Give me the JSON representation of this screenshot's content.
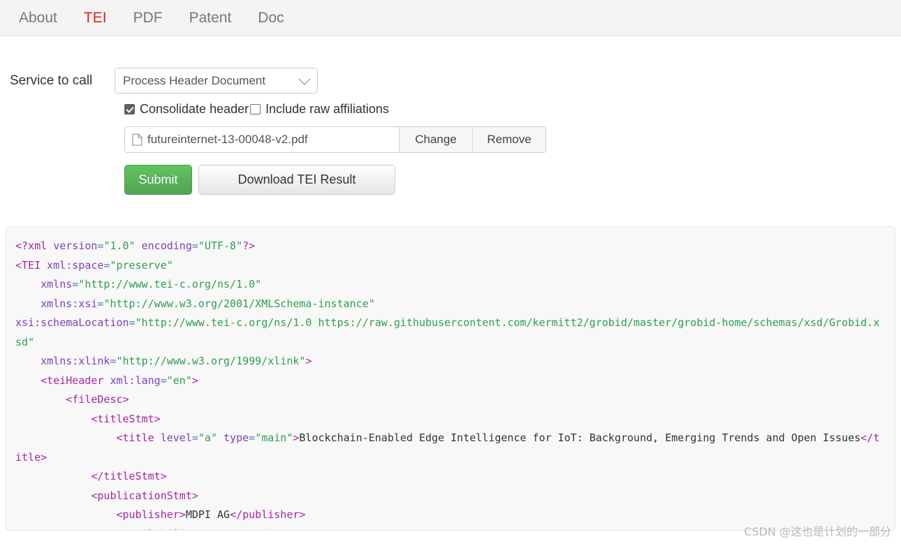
{
  "nav": {
    "items": [
      {
        "label": "About",
        "active": false
      },
      {
        "label": "TEI",
        "active": true
      },
      {
        "label": "PDF",
        "active": false
      },
      {
        "label": "Patent",
        "active": false
      },
      {
        "label": "Doc",
        "active": false
      }
    ],
    "active_color": "#d9241f",
    "inactive_color": "#777777",
    "background": "#f4f4f4"
  },
  "form": {
    "service_label": "Service to call",
    "service_selected": "Process Header Document",
    "dropdown_icon": "chevron-down-icon",
    "checkboxes": [
      {
        "label": "Consolidate header",
        "checked": true
      },
      {
        "label": "Include raw affiliations",
        "checked": false
      }
    ],
    "file": {
      "icon": "document-icon",
      "name": "futureinternet-13-00048-v2.pdf",
      "change_label": "Change",
      "remove_label": "Remove"
    },
    "submit_label": "Submit",
    "submit_color": "#5cb85c",
    "download_label": "Download TEI Result"
  },
  "code": {
    "language": "xml",
    "lines": [
      [
        {
          "t": "<?xml ",
          "c": "t-tag"
        },
        {
          "t": "version",
          "c": "t-attr"
        },
        {
          "t": "=",
          "c": "t-punc"
        },
        {
          "t": "\"1.0\"",
          "c": "t-val"
        },
        {
          "t": " ",
          "c": "t-txt"
        },
        {
          "t": "encoding",
          "c": "t-attr"
        },
        {
          "t": "=",
          "c": "t-punc"
        },
        {
          "t": "\"UTF-8\"",
          "c": "t-val"
        },
        {
          "t": "?>",
          "c": "t-tag"
        }
      ],
      [
        {
          "t": "<TEI ",
          "c": "t-tag"
        },
        {
          "t": "xml:space",
          "c": "t-attr"
        },
        {
          "t": "=",
          "c": "t-punc"
        },
        {
          "t": "\"preserve\"",
          "c": "t-val"
        }
      ],
      [
        {
          "t": "    ",
          "c": "t-txt"
        },
        {
          "t": "xmlns",
          "c": "t-attr"
        },
        {
          "t": "=",
          "c": "t-punc"
        },
        {
          "t": "\"http://www.tei-c.org/ns/1.0\"",
          "c": "t-val"
        }
      ],
      [
        {
          "t": "    ",
          "c": "t-txt"
        },
        {
          "t": "xmlns:xsi",
          "c": "t-attr"
        },
        {
          "t": "=",
          "c": "t-punc"
        },
        {
          "t": "\"http://www.w3.org/2001/XMLSchema-instance\"",
          "c": "t-val"
        }
      ],
      [
        {
          "t": "xsi:schemaLocation",
          "c": "t-attr"
        },
        {
          "t": "=",
          "c": "t-punc"
        },
        {
          "t": "\"http://www.tei-c.org/ns/1.0 https://raw.githubusercontent.com/kermitt2/grobid/master/grobid-home/schemas/xsd/Grobid.xsd\"",
          "c": "t-val"
        }
      ],
      [
        {
          "t": "    ",
          "c": "t-txt"
        },
        {
          "t": "xmlns:xlink",
          "c": "t-attr"
        },
        {
          "t": "=",
          "c": "t-punc"
        },
        {
          "t": "\"http://www.w3.org/1999/xlink\"",
          "c": "t-val"
        },
        {
          "t": ">",
          "c": "t-tag"
        }
      ],
      [
        {
          "t": "    ",
          "c": "t-txt"
        },
        {
          "t": "<teiHeader ",
          "c": "t-tag"
        },
        {
          "t": "xml:lang",
          "c": "t-attr"
        },
        {
          "t": "=",
          "c": "t-punc"
        },
        {
          "t": "\"en\"",
          "c": "t-val"
        },
        {
          "t": ">",
          "c": "t-tag"
        }
      ],
      [
        {
          "t": "        ",
          "c": "t-txt"
        },
        {
          "t": "<fileDesc>",
          "c": "t-tag"
        }
      ],
      [
        {
          "t": "            ",
          "c": "t-txt"
        },
        {
          "t": "<titleStmt>",
          "c": "t-tag"
        }
      ],
      [
        {
          "t": "                ",
          "c": "t-txt"
        },
        {
          "t": "<title ",
          "c": "t-tag"
        },
        {
          "t": "level",
          "c": "t-attr"
        },
        {
          "t": "=",
          "c": "t-punc"
        },
        {
          "t": "\"a\"",
          "c": "t-val"
        },
        {
          "t": " ",
          "c": "t-txt"
        },
        {
          "t": "type",
          "c": "t-attr"
        },
        {
          "t": "=",
          "c": "t-punc"
        },
        {
          "t": "\"main\"",
          "c": "t-val"
        },
        {
          "t": ">",
          "c": "t-tag"
        },
        {
          "t": "Blockchain-Enabled Edge Intelligence for IoT: Background, Emerging Trends and Open Issues",
          "c": "t-txt"
        },
        {
          "t": "</title>",
          "c": "t-tag"
        }
      ],
      [
        {
          "t": "            ",
          "c": "t-txt"
        },
        {
          "t": "</titleStmt>",
          "c": "t-tag"
        }
      ],
      [
        {
          "t": "            ",
          "c": "t-txt"
        },
        {
          "t": "<publicationStmt>",
          "c": "t-tag"
        }
      ],
      [
        {
          "t": "                ",
          "c": "t-txt"
        },
        {
          "t": "<publisher>",
          "c": "t-tag"
        },
        {
          "t": "MDPI AG",
          "c": "t-txt"
        },
        {
          "t": "</publisher>",
          "c": "t-tag"
        }
      ],
      [
        {
          "t": "                ",
          "c": "t-txt"
        },
        {
          "t": "<availability ",
          "c": "t-tag"
        },
        {
          "t": "status",
          "c": "t-attr"
        },
        {
          "t": "=",
          "c": "t-punc"
        },
        {
          "t": "\"unknown\"",
          "c": "t-val"
        },
        {
          "t": ">",
          "c": "t-tag"
        }
      ]
    ]
  },
  "watermark": {
    "text": "CSDN @这也是计划的一部分"
  }
}
